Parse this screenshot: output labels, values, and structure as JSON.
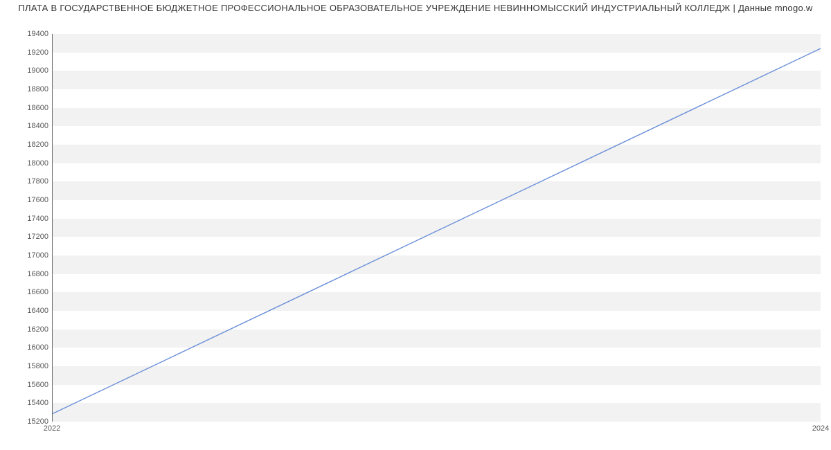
{
  "chart_data": {
    "type": "line",
    "title": "ПЛАТА В ГОСУДАРСТВЕННОЕ БЮДЖЕТНОЕ ПРОФЕССИОНАЛЬНОЕ ОБРАЗОВАТЕЛЬНОЕ УЧРЕЖДЕНИЕ НЕВИННОМЫССКИЙ ИНДУСТРИАЛЬНЫЙ КОЛЛЕДЖ | Данные mnogo.w",
    "x": [
      2022,
      2024
    ],
    "values": [
      15279,
      19242
    ],
    "xlabel": "",
    "ylabel": "",
    "x_ticks": [
      2022,
      2024
    ],
    "y_ticks": [
      15200,
      15400,
      15600,
      15800,
      16000,
      16200,
      16400,
      16600,
      16800,
      17000,
      17200,
      17400,
      17600,
      17800,
      18000,
      18200,
      18400,
      18600,
      18800,
      19000,
      19200,
      19400
    ],
    "ylim": [
      15200,
      19400
    ],
    "xlim": [
      2022,
      2024
    ]
  }
}
